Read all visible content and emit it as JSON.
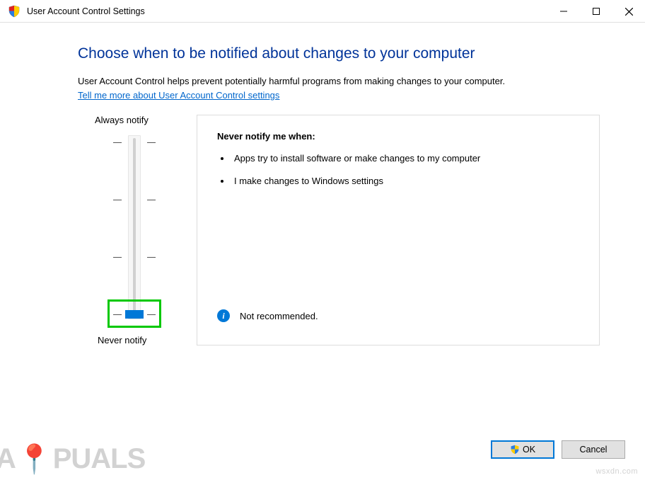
{
  "window": {
    "title": "User Account Control Settings"
  },
  "heading": "Choose when to be notified about changes to your computer",
  "description": "User Account Control helps prevent potentially harmful programs from making changes to your computer.",
  "link_text": "Tell me more about User Account Control settings",
  "slider": {
    "top_label": "Always notify",
    "bottom_label": "Never notify",
    "selected_level": 0
  },
  "info": {
    "title": "Never notify me when:",
    "bullets": [
      "Apps try to install software or make changes to my computer",
      "I make changes to Windows settings"
    ],
    "recommendation": "Not recommended."
  },
  "buttons": {
    "ok": "OK",
    "cancel": "Cancel"
  },
  "watermark": {
    "brand": "A   PUALS",
    "site": "wsxdn.com"
  }
}
